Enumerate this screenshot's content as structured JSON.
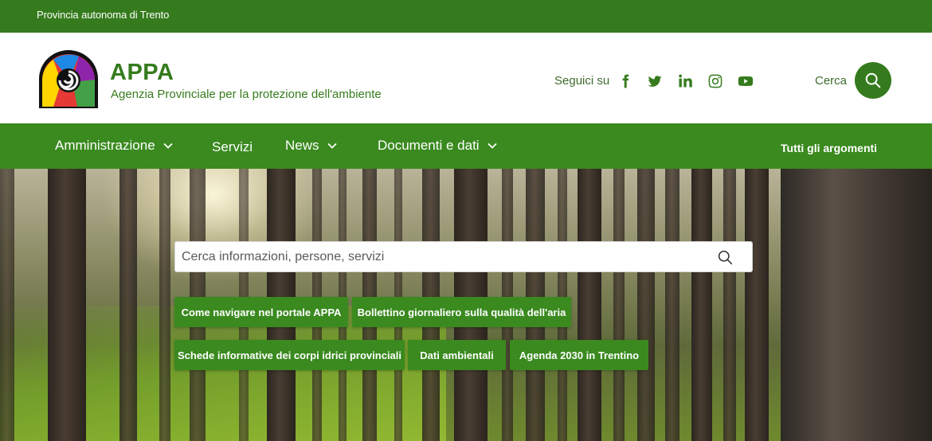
{
  "topbar": {
    "region": "Provincia autonoma di Trento"
  },
  "header": {
    "title": "APPA",
    "subtitle": "Agenzia Provinciale per la protezione dell'ambiente",
    "follow_label": "Seguici su",
    "social_icons": [
      "facebook-icon",
      "twitter-icon",
      "linkedin-icon",
      "instagram-icon",
      "youtube-icon"
    ],
    "search_label": "Cerca"
  },
  "nav": {
    "items": [
      {
        "label": "Amministrazione",
        "has_dropdown": true
      },
      {
        "label": "Servizi",
        "has_dropdown": false
      },
      {
        "label": "News",
        "has_dropdown": true
      },
      {
        "label": "Documenti e dati",
        "has_dropdown": true
      }
    ],
    "topics_label": "Tutti gli argomenti"
  },
  "hero": {
    "search_placeholder": "Cerca informazioni, persone, servizi",
    "quick_links": [
      "Come navigare nel portale APPA",
      "Bollettino giornaliero sulla qualità dell'aria",
      "Schede informative dei corpi idrici provinciali",
      "Dati ambientali",
      "Agenda 2030 in Trentino"
    ]
  },
  "colors": {
    "primary_green": "#357b1d",
    "nav_green": "#3a8a1f",
    "white": "#ffffff"
  }
}
